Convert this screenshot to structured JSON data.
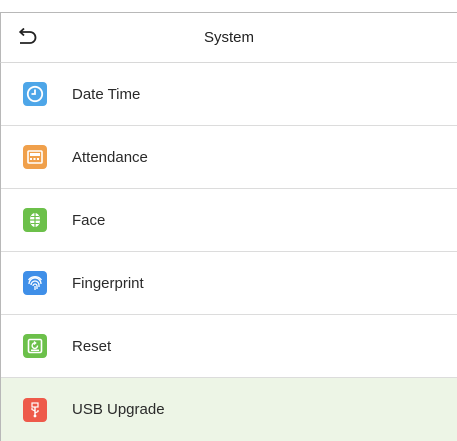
{
  "header": {
    "title": "System",
    "back_icon": "back-arrow-icon"
  },
  "menu": {
    "items": [
      {
        "label": "Date Time",
        "icon": "clock-icon",
        "icon_color": "#4ea6e8"
      },
      {
        "label": "Attendance",
        "icon": "attendance-icon",
        "icon_color": "#f0a04b"
      },
      {
        "label": "Face",
        "icon": "face-icon",
        "icon_color": "#6cc04a"
      },
      {
        "label": "Fingerprint",
        "icon": "fingerprint-icon",
        "icon_color": "#3f8fe8"
      },
      {
        "label": "Reset",
        "icon": "reset-icon",
        "icon_color": "#6cc04a"
      },
      {
        "label": "USB Upgrade",
        "icon": "usb-icon",
        "icon_color": "#ee5a4a",
        "selected": true
      }
    ]
  },
  "colors": {
    "selected_row_background": "#edf5e6"
  }
}
